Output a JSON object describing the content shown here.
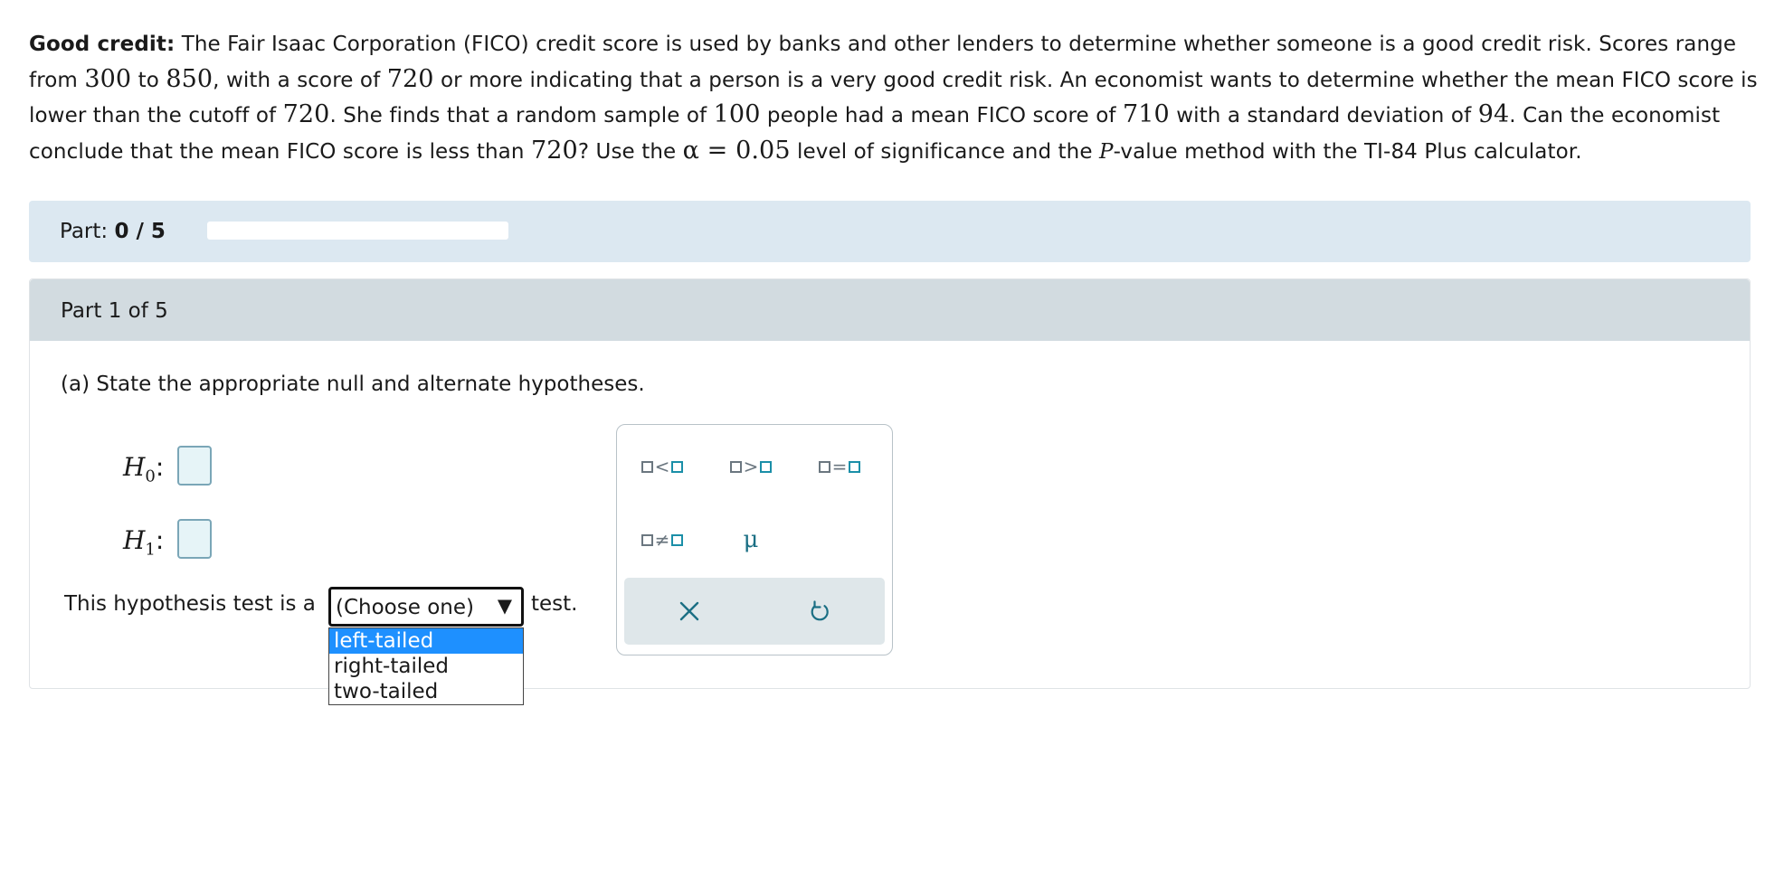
{
  "problem": {
    "lead": "Good credit:",
    "t1": " The Fair Isaac Corporation (FICO) credit score is used by banks and other lenders to determine whether someone is a good credit risk. Scores range from ",
    "v_min": "300",
    "t2": " to ",
    "v_max": "850",
    "t3": ", with a score of ",
    "v_cut1": "720",
    "t4": " or more indicating that a person is a very good credit risk. An economist wants to determine whether the mean FICO score is lower than the cutoff of ",
    "v_cut2": "720",
    "t5": ". She finds that a random sample of ",
    "v_n": "100",
    "t6": " people had a mean FICO score of ",
    "v_mean": "710",
    "t7": " with a standard deviation of ",
    "v_sd": "94",
    "t8": ". Can the economist conclude that the mean FICO score is less than ",
    "v_cut3": "720",
    "t9": "? Use the ",
    "alpha": "α = 0.05",
    "t10": " level of significance and the ",
    "p": "P",
    "t11": "-value method with the TI-84 Plus calculator."
  },
  "progress": {
    "label": "Part:",
    "value": "0 / 5",
    "fraction": 0
  },
  "part": {
    "title": "Part 1 of 5",
    "question": "(a) State the appropriate null and alternate hypotheses.",
    "h0_letter": "H",
    "h0_sub": "0",
    "h1_letter": "H",
    "h1_sub": "1",
    "colon": ":",
    "test_prefix": "This hypothesis test is a",
    "test_suffix": "test."
  },
  "tail_select": {
    "value": "(Choose one)",
    "arrow": "▼",
    "options": [
      "left-tailed",
      "right-tailed",
      "two-tailed"
    ],
    "highlighted_index": 0
  },
  "keypad": {
    "keys": [
      "<",
      ">",
      "=",
      "≠",
      "μ"
    ],
    "icons": [
      "close-icon",
      "undo-icon"
    ]
  },
  "colors": {
    "progress_bar_bg": "#dce8f1",
    "part_header_bg": "#d2dbe0",
    "option_highlight": "#1e90ff",
    "answer_box_fill": "#e6f4f7"
  }
}
